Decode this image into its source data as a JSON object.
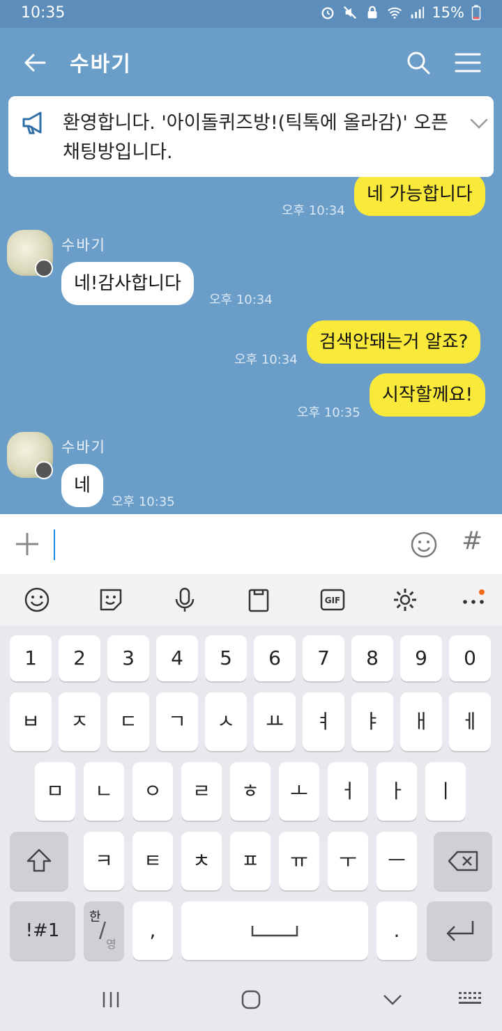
{
  "status": {
    "time": "10:35",
    "battery": "15%",
    "icons": [
      "alarm-icon",
      "mute-icon",
      "lock-icon",
      "wifi-icon",
      "signal-icon",
      "battery-icon"
    ]
  },
  "header": {
    "title": "수바기"
  },
  "notice": {
    "text": "환영합니다. '아이돌퀴즈방!(틱톡에 올라감)' 오픈채팅방입니다."
  },
  "messages": [
    {
      "sender": "",
      "text": "네 가능합니다",
      "mine": true,
      "time": "오후 10:34"
    },
    {
      "sender": "수바기",
      "text": "네!감사합니다",
      "mine": false,
      "time": "오후 10:34"
    },
    {
      "sender": "",
      "text": "검색안돼는거 알죠?",
      "mine": true,
      "time": "오후 10:34"
    },
    {
      "sender": "",
      "text": "시작할께요!",
      "mine": true,
      "time": "오후 10:35"
    },
    {
      "sender": "수바기",
      "text": "네",
      "mine": false,
      "time": "오후 10:35"
    }
  ],
  "input": {
    "hash": "#",
    "value": ""
  },
  "keyboard": {
    "toolbar_icons": [
      "emoji-icon",
      "sticker-icon",
      "microphone-icon",
      "clipboard-icon",
      "gif-icon",
      "settings-icon",
      "more-icon"
    ],
    "gif_label": "GIF",
    "row_numbers": [
      "1",
      "2",
      "3",
      "4",
      "5",
      "6",
      "7",
      "8",
      "9",
      "0"
    ],
    "row1": [
      "ㅂ",
      "ㅈ",
      "ㄷ",
      "ㄱ",
      "ㅅ",
      "ㅛ",
      "ㅕ",
      "ㅑ",
      "ㅐ",
      "ㅔ"
    ],
    "row2": [
      "ㅁ",
      "ㄴ",
      "ㅇ",
      "ㄹ",
      "ㅎ",
      "ㅗ",
      "ㅓ",
      "ㅏ",
      "ㅣ"
    ],
    "row3": [
      "ㅋ",
      "ㅌ",
      "ㅊ",
      "ㅍ",
      "ㅠ",
      "ㅜ",
      "ㅡ"
    ],
    "symbols_label": "!#1",
    "lang_top": "한",
    "lang_bottom": "영",
    "comma": ",",
    "period": "."
  },
  "colors": {
    "chat_bg": "#6a9ec9",
    "my_bubble": "#f9e93a",
    "their_bubble": "#ffffff",
    "keyboard_bg": "#e8e9ee"
  }
}
